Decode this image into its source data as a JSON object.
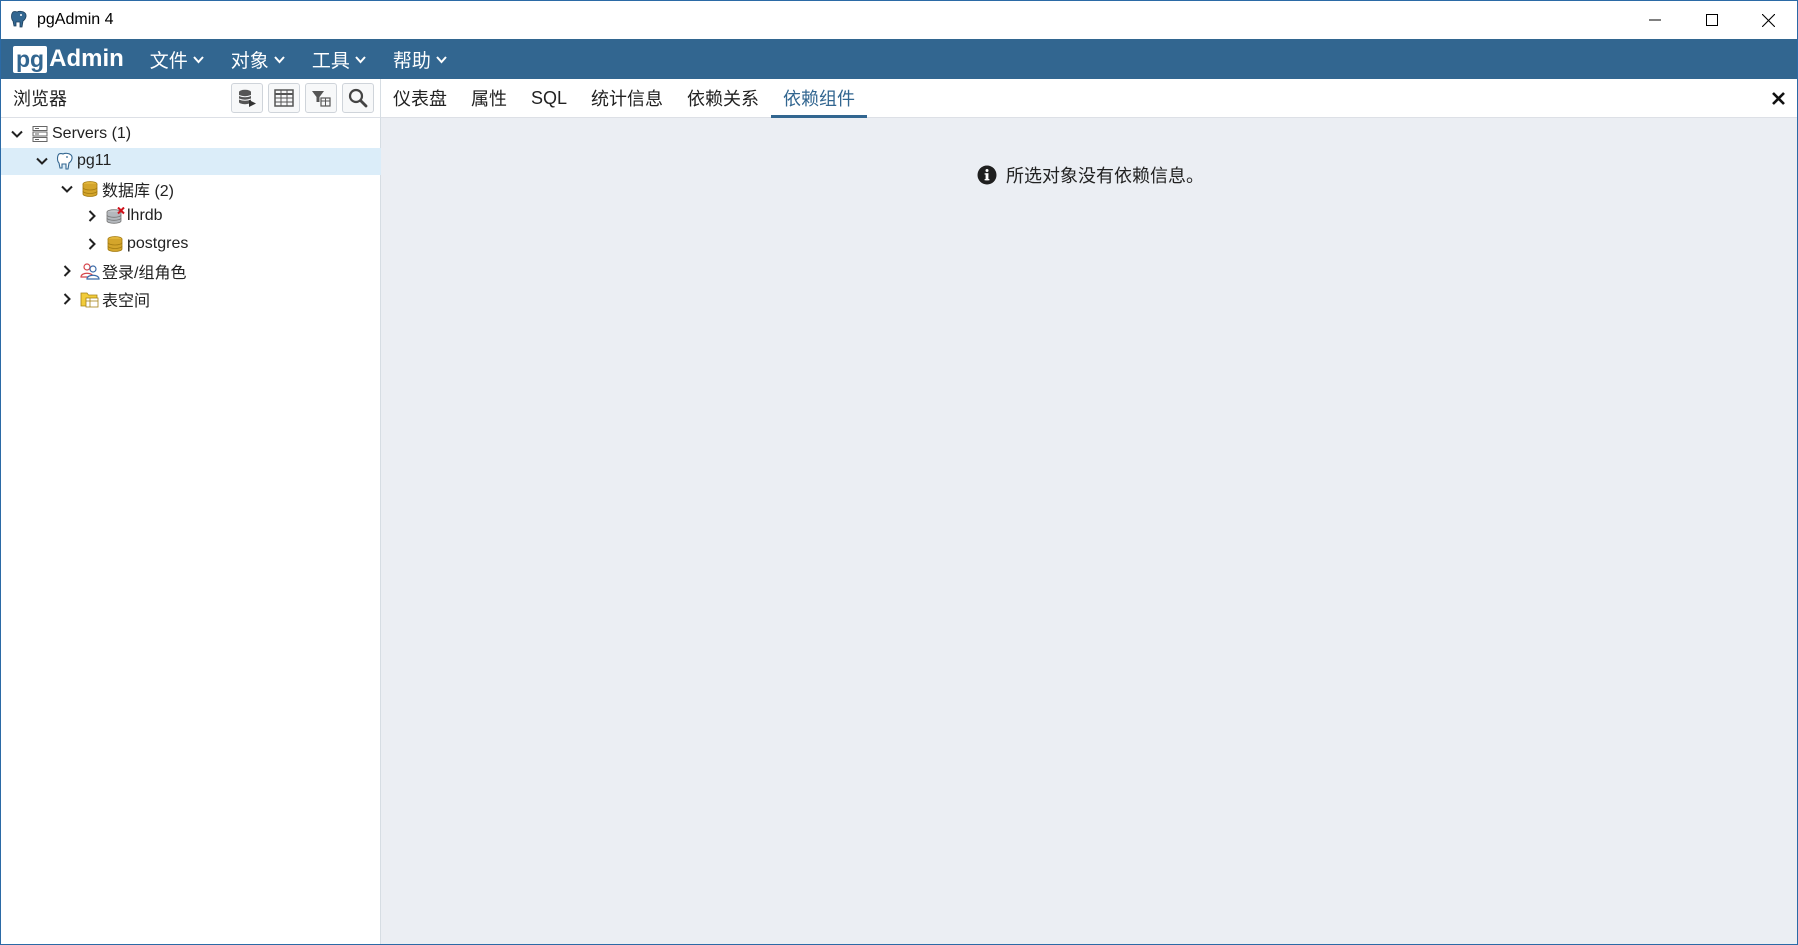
{
  "window": {
    "title": "pgAdmin 4"
  },
  "logo": {
    "pg": "pg",
    "admin": "Admin"
  },
  "menu": [
    {
      "label": "文件"
    },
    {
      "label": "对象"
    },
    {
      "label": "工具"
    },
    {
      "label": "帮助"
    }
  ],
  "browser": {
    "title": "浏览器",
    "tree": {
      "servers": "Servers (1)",
      "server": "pg11",
      "databases": "数据库 (2)",
      "db1": "lhrdb",
      "db2": "postgres",
      "roles": "登录/组角色",
      "tablespaces": "表空间"
    }
  },
  "tabs": [
    {
      "label": "仪表盘"
    },
    {
      "label": "属性"
    },
    {
      "label": "SQL"
    },
    {
      "label": "统计信息"
    },
    {
      "label": "依赖关系"
    },
    {
      "label": "依赖组件"
    }
  ],
  "active_tab": "依赖组件",
  "content": {
    "message": "所选对象没有依赖信息。"
  },
  "colors": {
    "accent": "#326690",
    "panel_bg": "#ebeef3",
    "selected_bg": "#dbedf9"
  }
}
